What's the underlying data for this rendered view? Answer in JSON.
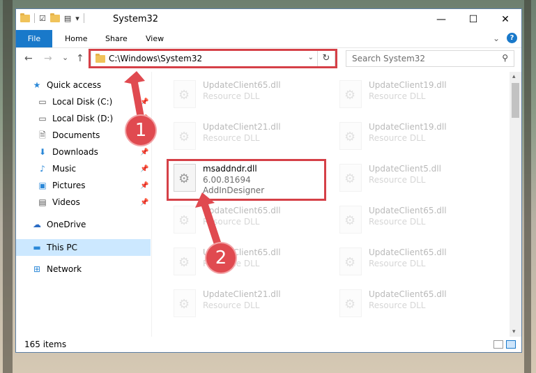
{
  "window": {
    "title": "System32"
  },
  "qat": {
    "dropdown_glyph": "▾"
  },
  "controls": {
    "minimize": "—",
    "maximize": "☐",
    "close": "✕"
  },
  "ribbon": {
    "tabs": [
      "File",
      "Home",
      "Share",
      "View"
    ],
    "expand_glyph": "⌄",
    "help_glyph": "?"
  },
  "nav": {
    "back": "←",
    "forward": "→",
    "recent": "⌄",
    "up": "↑"
  },
  "address": {
    "path": "C:\\Windows\\System32",
    "dropdown": "⌄",
    "refresh": "↻"
  },
  "search": {
    "placeholder": "Search System32",
    "icon": "search-icon"
  },
  "sidebar": {
    "items": [
      {
        "label": "Quick access",
        "icon": "star-icon",
        "glyph": "★"
      },
      {
        "label": "Local Disk (C:)",
        "icon": "drive-icon",
        "glyph": "▭",
        "pinned": true
      },
      {
        "label": "Local Disk (D:)",
        "icon": "drive-icon",
        "glyph": "▭",
        "pinned": true
      },
      {
        "label": "Documents",
        "icon": "document-icon",
        "glyph": "🗎",
        "pinned": true
      },
      {
        "label": "Downloads",
        "icon": "download-icon",
        "glyph": "⬇",
        "pinned": true
      },
      {
        "label": "Music",
        "icon": "music-icon",
        "glyph": "♪",
        "pinned": true
      },
      {
        "label": "Pictures",
        "icon": "pictures-icon",
        "glyph": "▣",
        "pinned": true
      },
      {
        "label": "Videos",
        "icon": "video-icon",
        "glyph": "▤",
        "pinned": true
      },
      {
        "label": "OneDrive",
        "icon": "cloud-icon",
        "glyph": "☁"
      },
      {
        "label": "This PC",
        "icon": "computer-icon",
        "glyph": "▬",
        "selected": true
      },
      {
        "label": "Network",
        "icon": "network-icon",
        "glyph": "⊞"
      }
    ],
    "pin_glyph": "📌"
  },
  "files": [
    {
      "name": "UpdateClient65.dll",
      "type": "Resource DLL"
    },
    {
      "name": "UpdateClient19.dll",
      "type": "Resource DLL"
    },
    {
      "name": "UpdateClient21.dll",
      "type": "Resource DLL"
    },
    {
      "name": "UpdateClient19.dll",
      "type": "Resource DLL"
    },
    {
      "name": "msaddndr.dll",
      "version": "6.00.81694",
      "type": "AddInDesigner",
      "highlighted": true
    },
    {
      "name": "UpdateClient5.dll",
      "type": "Resource DLL"
    },
    {
      "name": "UpdateClient65.dll",
      "type": "Resource DLL"
    },
    {
      "name": "UpdateClient65.dll",
      "type": "Resource DLL"
    },
    {
      "name": "UpdateClient65.dll",
      "type": "Resource DLL"
    },
    {
      "name": "UpdateClient65.dll",
      "type": "Resource DLL"
    },
    {
      "name": "UpdateClient21.dll",
      "type": "Resource DLL"
    },
    {
      "name": "UpdateClient65.dll",
      "type": "Resource DLL"
    }
  ],
  "scrollbar": {
    "up": "▴",
    "down": "▾"
  },
  "status": {
    "item_count": "165 items"
  },
  "annotations": {
    "step1": "1",
    "step2": "2",
    "color": "#e04a50"
  }
}
